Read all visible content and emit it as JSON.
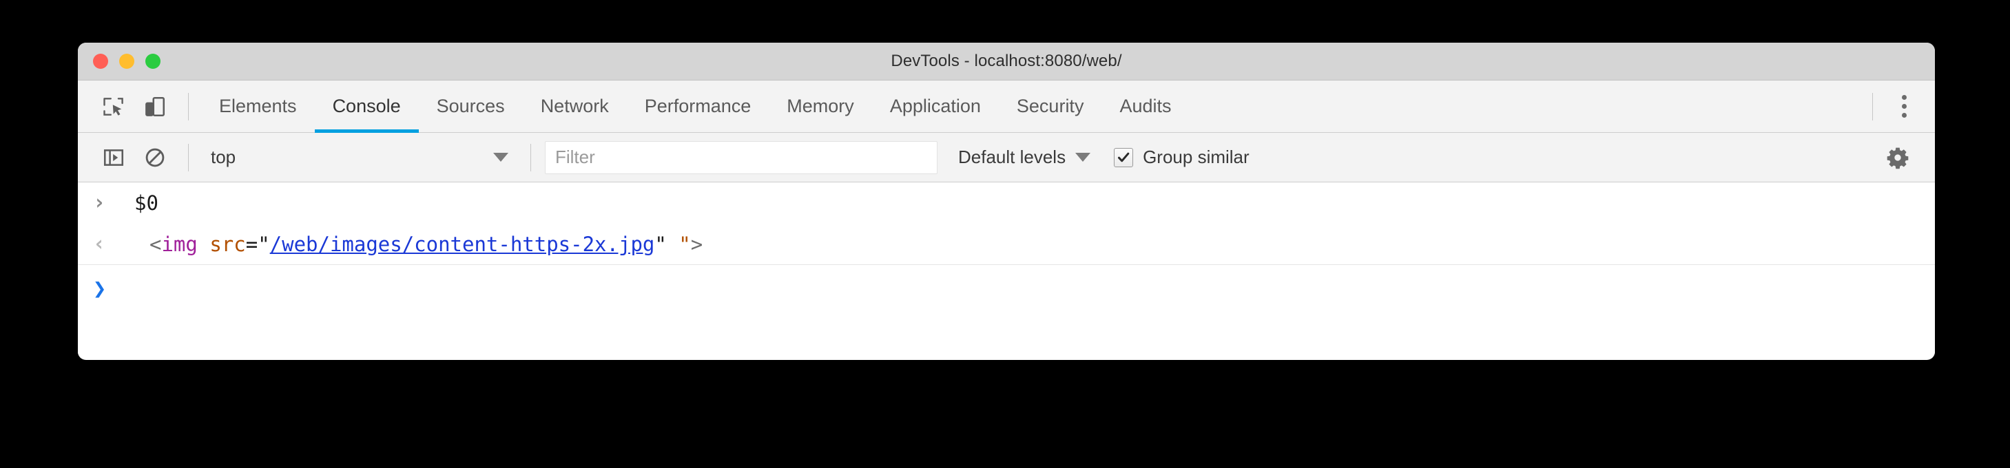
{
  "window": {
    "title": "DevTools - localhost:8080/web/",
    "traffic_lights": [
      {
        "name": "close",
        "color": "#ff5f56"
      },
      {
        "name": "minimize",
        "color": "#ffbd2e"
      },
      {
        "name": "maximize",
        "color": "#2bcc40"
      }
    ]
  },
  "toolbar": {
    "inspect_icon": "inspect-element-icon",
    "device_icon": "device-toolbar-icon",
    "more_icon": "kebab-menu-icon",
    "tabs": [
      {
        "label": "Elements",
        "active": false
      },
      {
        "label": "Console",
        "active": true
      },
      {
        "label": "Sources",
        "active": false
      },
      {
        "label": "Network",
        "active": false
      },
      {
        "label": "Performance",
        "active": false
      },
      {
        "label": "Memory",
        "active": false
      },
      {
        "label": "Application",
        "active": false
      },
      {
        "label": "Security",
        "active": false
      },
      {
        "label": "Audits",
        "active": false
      }
    ],
    "active_tab_underline_color": "#00a0e0"
  },
  "filterbar": {
    "sidebar_toggle_icon": "console-sidebar-icon",
    "clear_console_icon": "clear-console-icon",
    "context": {
      "value": "top",
      "caret_icon": "chevron-down-icon"
    },
    "filter": {
      "placeholder": "Filter",
      "value": ""
    },
    "levels": {
      "label": "Default levels",
      "caret_icon": "chevron-down-icon"
    },
    "group_similar": {
      "label": "Group similar",
      "checked": true
    },
    "settings_icon": "gear-icon"
  },
  "console": {
    "rows": [
      {
        "type": "input",
        "gutter_glyph": "›",
        "text": "$0"
      },
      {
        "type": "result",
        "gutter_glyph": "‹",
        "tokens": {
          "open_bracket": "<",
          "tag": "img",
          "space": " ",
          "attr": "src",
          "equals": "=",
          "quote_open": "\"",
          "url": "/web/images/content-https-2x.jpg",
          "quote_close": "\"",
          "gap": " ",
          "quote_extra": "\"",
          "close_bracket": ">"
        },
        "full_text": "<img src=\"/web/images/content-https-2x.jpg\" \">"
      },
      {
        "type": "prompt",
        "gutter_glyph": "❯",
        "text": ""
      }
    ]
  },
  "colors": {
    "accent": "#00a0e0",
    "titlebar_bg": "#d5d5d5",
    "toolbar_bg": "#f3f3f3",
    "console_bg": "#ffffff",
    "link": "#1a38d6",
    "tag": "#a0209a",
    "attr": "#b25000",
    "prompt": "#1a73e8"
  }
}
